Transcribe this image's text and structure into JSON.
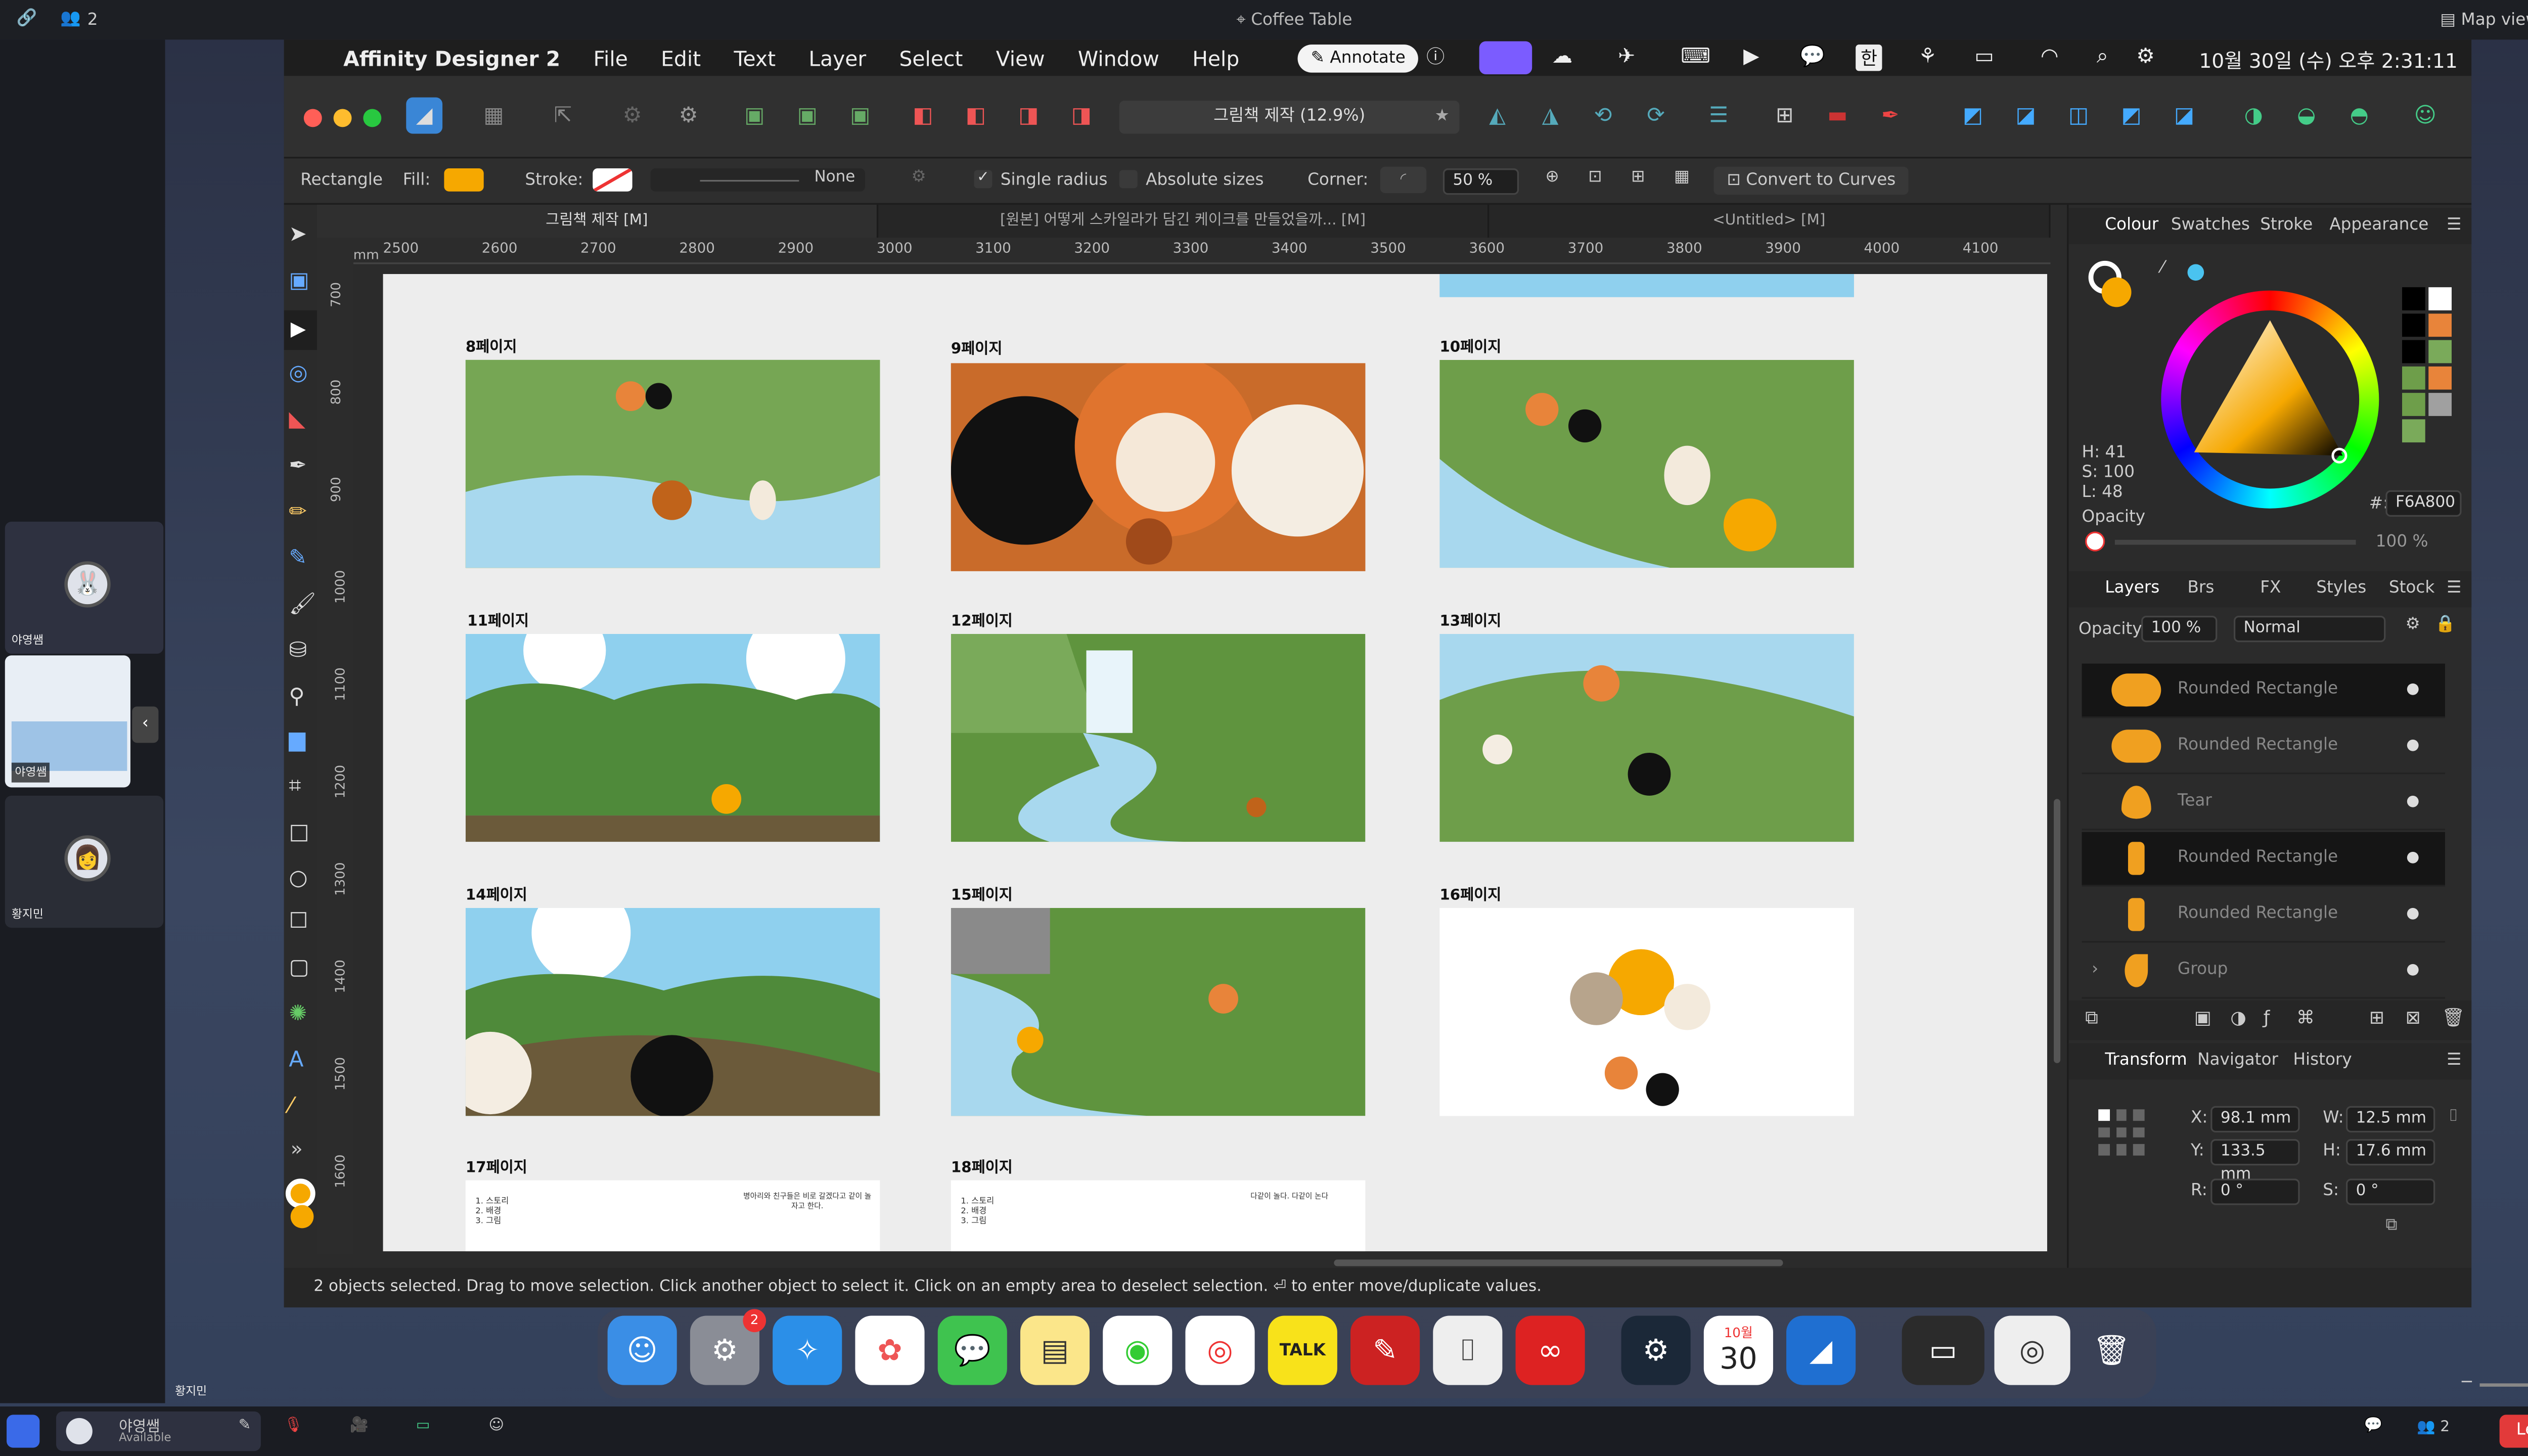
{
  "callbar": {
    "participant_count": "2",
    "title": "Coffee Table",
    "map_view": "Map view"
  },
  "participants": [
    {
      "name": "야영쌤"
    },
    {
      "name": "야영쌤"
    },
    {
      "name": "황지민"
    }
  ],
  "menubar": {
    "app": "Affinity Designer 2",
    "items": [
      "File",
      "Edit",
      "Text",
      "Layer",
      "Select",
      "View",
      "Window",
      "Help"
    ],
    "annotate": "Annotate",
    "clock": "10월 30일 (수) 오후 2:31:11",
    "input_lang": "한"
  },
  "toolbar": {
    "doc_title": "그림책 제작 (12.9%)"
  },
  "context": {
    "tool": "Rectangle",
    "fill_label": "Fill:",
    "stroke_label": "Stroke:",
    "stroke_value": "None",
    "single_radius": "Single radius",
    "absolute_sizes": "Absolute sizes",
    "corner_label": "Corner:",
    "corner_value": "50 %",
    "convert": "Convert to Curves",
    "fill_color": "#F6A800"
  },
  "tabs": [
    "그림책 제작 [M]",
    "[원본] 어떻게 스카일라가 담긴 케이크를 만들었을까... [M]",
    "<Untitled> [M]"
  ],
  "ruler": {
    "unit": "mm",
    "ticks": [
      "2500",
      "2600",
      "2700",
      "2800",
      "2900",
      "3000",
      "3100",
      "3200",
      "3300",
      "3400",
      "3500",
      "3600",
      "3700",
      "3800",
      "3900",
      "4000",
      "4100"
    ],
    "vticks": [
      "700",
      "800",
      "900",
      "1000",
      "1100",
      "1200",
      "1300",
      "1400",
      "1500",
      "1600"
    ]
  },
  "pages": [
    {
      "label": "8페이지"
    },
    {
      "label": "9페이지"
    },
    {
      "label": "10페이지"
    },
    {
      "label": "11페이지"
    },
    {
      "label": "12페이지"
    },
    {
      "label": "13페이지"
    },
    {
      "label": "14페이지"
    },
    {
      "label": "15페이지"
    },
    {
      "label": "16페이지"
    },
    {
      "label": "17페이지"
    },
    {
      "label": "18페이지"
    }
  ],
  "page_text": {
    "list": [
      "1. 스토리",
      "2. 배경",
      "3. 그림"
    ],
    "p17_note": "병아리와 친구들은 비로 갈겠다고 같이 놀자고 한다.",
    "p18_note": "다같이 놀다. 다같이 논다"
  },
  "status": "2 objects selected. Drag to move selection. Click another object to select it. Click on an empty area to deselect selection. ⏎ to enter move/duplicate values.",
  "colour_panel": {
    "tabs": [
      "Colour",
      "Swatches",
      "Stroke",
      "Appearance"
    ],
    "h": "H: 41",
    "s": "S: 100",
    "l": "L: 48",
    "hex_label": "#:",
    "hex": "F6A800",
    "opacity_label": "Opacity",
    "opacity": "100 %"
  },
  "layers_panel": {
    "tabs": [
      "Layers",
      "Brs",
      "FX",
      "Styles",
      "Stock"
    ],
    "opacity_label": "Opacity:",
    "opacity": "100 %",
    "blend": "Normal",
    "items": [
      "Rounded Rectangle",
      "Rounded Rectangle",
      "Tear",
      "Rounded Rectangle",
      "Rounded Rectangle",
      "Group"
    ]
  },
  "transform_panel": {
    "tabs": [
      "Transform",
      "Navigator",
      "History"
    ],
    "x_label": "X:",
    "x": "98.1 mm",
    "y_label": "Y:",
    "y": "133.5 mm",
    "w_label": "W:",
    "w": "12.5 mm",
    "h_label": "H:",
    "h": "17.6 mm",
    "r_label": "R:",
    "r": "0 °",
    "s_label": "S:",
    "s": "0 °"
  },
  "dock": {
    "badge": "2",
    "calendar_month": "10월",
    "calendar_day": "30",
    "talk": "TALK"
  },
  "bottombar": {
    "user": "야영쌤",
    "user_status": "Available",
    "count": "2",
    "leave": "Leave",
    "pip_name": "황지민"
  }
}
